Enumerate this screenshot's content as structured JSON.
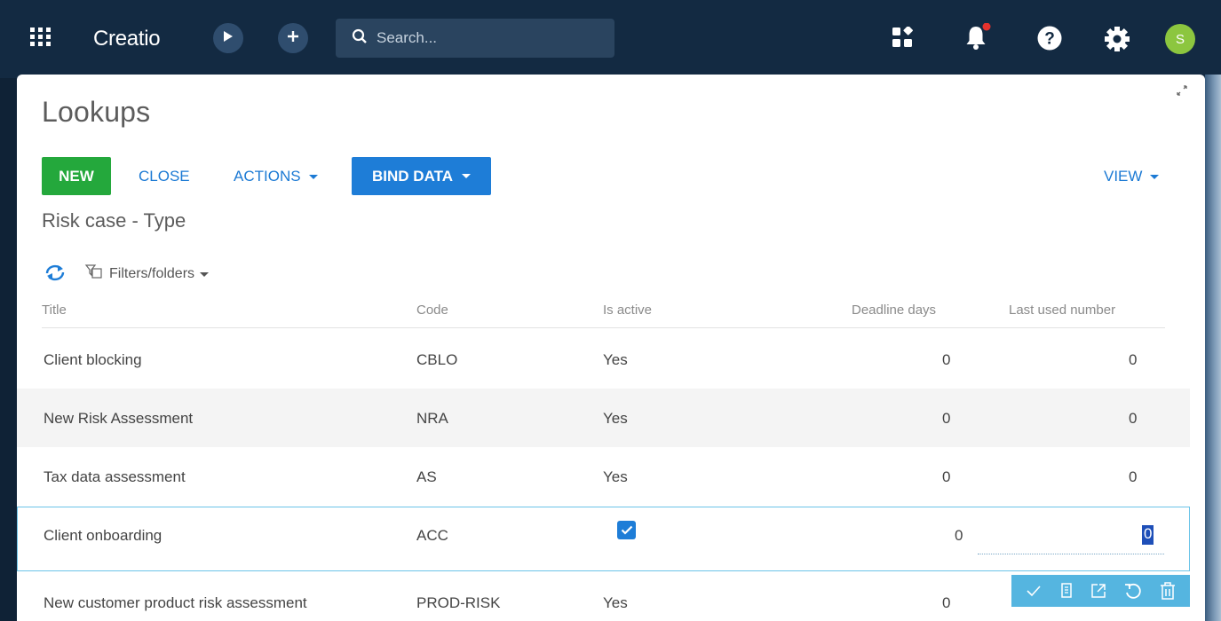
{
  "topbar": {
    "logo": "Creatio",
    "search_placeholder": "Search...",
    "avatar_initial": "S",
    "icons": [
      "apps-grid-icon",
      "play-icon",
      "plus-icon",
      "search-icon",
      "widgets-icon",
      "bell-icon",
      "help-icon",
      "gear-icon"
    ]
  },
  "page": {
    "title": "Lookups",
    "section_title": "Risk case - Type"
  },
  "toolbar": {
    "new_label": "NEW",
    "close_label": "CLOSE",
    "actions_label": "ACTIONS",
    "bind_data_label": "BIND DATA",
    "view_label": "VIEW"
  },
  "filters": {
    "label": "Filters/folders"
  },
  "grid": {
    "columns": [
      "Title",
      "Code",
      "Is active",
      "Deadline days",
      "Last used number"
    ],
    "rows": [
      {
        "title": "Client blocking",
        "code": "CBLO",
        "is_active": "Yes",
        "deadline_days": "0",
        "last_used_number": "0"
      },
      {
        "title": "New Risk Assessment",
        "code": "NRA",
        "is_active": "Yes",
        "deadline_days": "0",
        "last_used_number": "0"
      },
      {
        "title": "Tax data assessment",
        "code": "AS",
        "is_active": "Yes",
        "deadline_days": "0",
        "last_used_number": "0"
      },
      {
        "title": "Client onboarding",
        "code": "ACC",
        "is_active": "checked",
        "deadline_days": "0",
        "last_used_number": "0"
      },
      {
        "title": "New customer product risk assessment",
        "code": "PROD-RISK",
        "is_active": "Yes",
        "deadline_days": "0",
        "last_used_number": ""
      }
    ],
    "editing_row_index": 3
  },
  "colors": {
    "topbar": "#132a42",
    "new_button": "#24a83c",
    "primary": "#1e7dd7",
    "link": "#1c7ad4",
    "selection_border": "#6cc4e8",
    "row_actions": "#55b5e0",
    "avatar": "#8cc63f",
    "notification_dot": "#e5322d"
  }
}
